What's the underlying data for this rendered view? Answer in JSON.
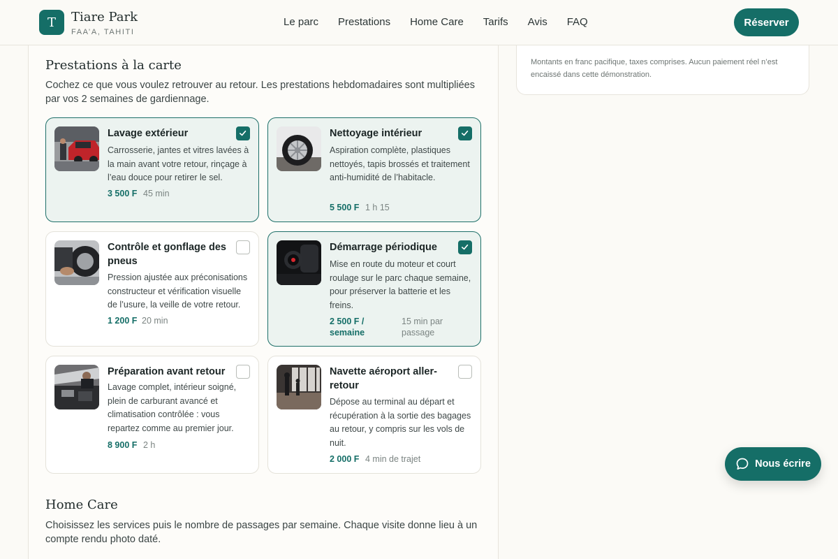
{
  "header": {
    "logo_letter": "T",
    "brand": "Tiare Park",
    "location": "FAA’A, TAHITI",
    "nav": [
      "Le parc",
      "Prestations",
      "Home Care",
      "Tarifs",
      "Avis",
      "FAQ"
    ],
    "cta": "Réserver"
  },
  "summary": {
    "note": "Montants en franc pacifique, taxes comprises. Aucun paiement réel n’est encaissé dans cette démonstration."
  },
  "prestations": {
    "title": "Prestations à la carte",
    "description": "Cochez ce que vous voulez retrouver au retour. Les prestations hebdomadaires sont multipliées par vos 2 semaines de gardiennage.",
    "cards": [
      {
        "title": "Lavage extérieur",
        "description": "Carrosserie, jantes et vitres lavées à la main avant votre retour, rinçage à l’eau douce pour retirer le sel.",
        "price": "3 500 F",
        "duration": "45 min",
        "selected": true
      },
      {
        "title": "Nettoyage intérieur",
        "description": "Aspiration complète, plastiques nettoyés, tapis brossés et traitement anti-humidité de l’habitacle.",
        "price": "5 500 F",
        "duration": "1 h 15",
        "selected": true
      },
      {
        "title": "Contrôle et gonflage des pneus",
        "description": "Pression ajustée aux préconisations constructeur et vérification visuelle de l’usure, la veille de votre retour.",
        "price": "1 200 F",
        "duration": "20 min",
        "selected": false
      },
      {
        "title": "Démarrage périodique",
        "description": "Mise en route du moteur et court roulage sur le parc chaque semaine, pour préserver la batterie et les freins.",
        "price": "2 500 F / semaine",
        "duration": "15 min par passage",
        "selected": true
      },
      {
        "title": "Préparation avant retour",
        "description": "Lavage complet, intérieur soigné, plein de carburant avancé et climatisation contrôlée : vous repartez comme au premier jour.",
        "price": "8 900 F",
        "duration": "2 h",
        "selected": false
      },
      {
        "title": "Navette aéroport aller-retour",
        "description": "Dépose au terminal au départ et récupération à la sortie des bagages au retour, y compris sur les vols de nuit.",
        "price": "2 000 F",
        "duration": "4 min de trajet",
        "selected": false
      }
    ]
  },
  "homecare": {
    "title": "Home Care",
    "description": "Choisissez les services puis le nombre de passages par semaine. Chaque visite donne lieu à un compte rendu photo daté."
  },
  "chat": {
    "label": "Nous écrire"
  },
  "colors": {
    "accent": "#156e67",
    "selected_bg": "#ecf3f0",
    "background": "#fbfaf6"
  }
}
